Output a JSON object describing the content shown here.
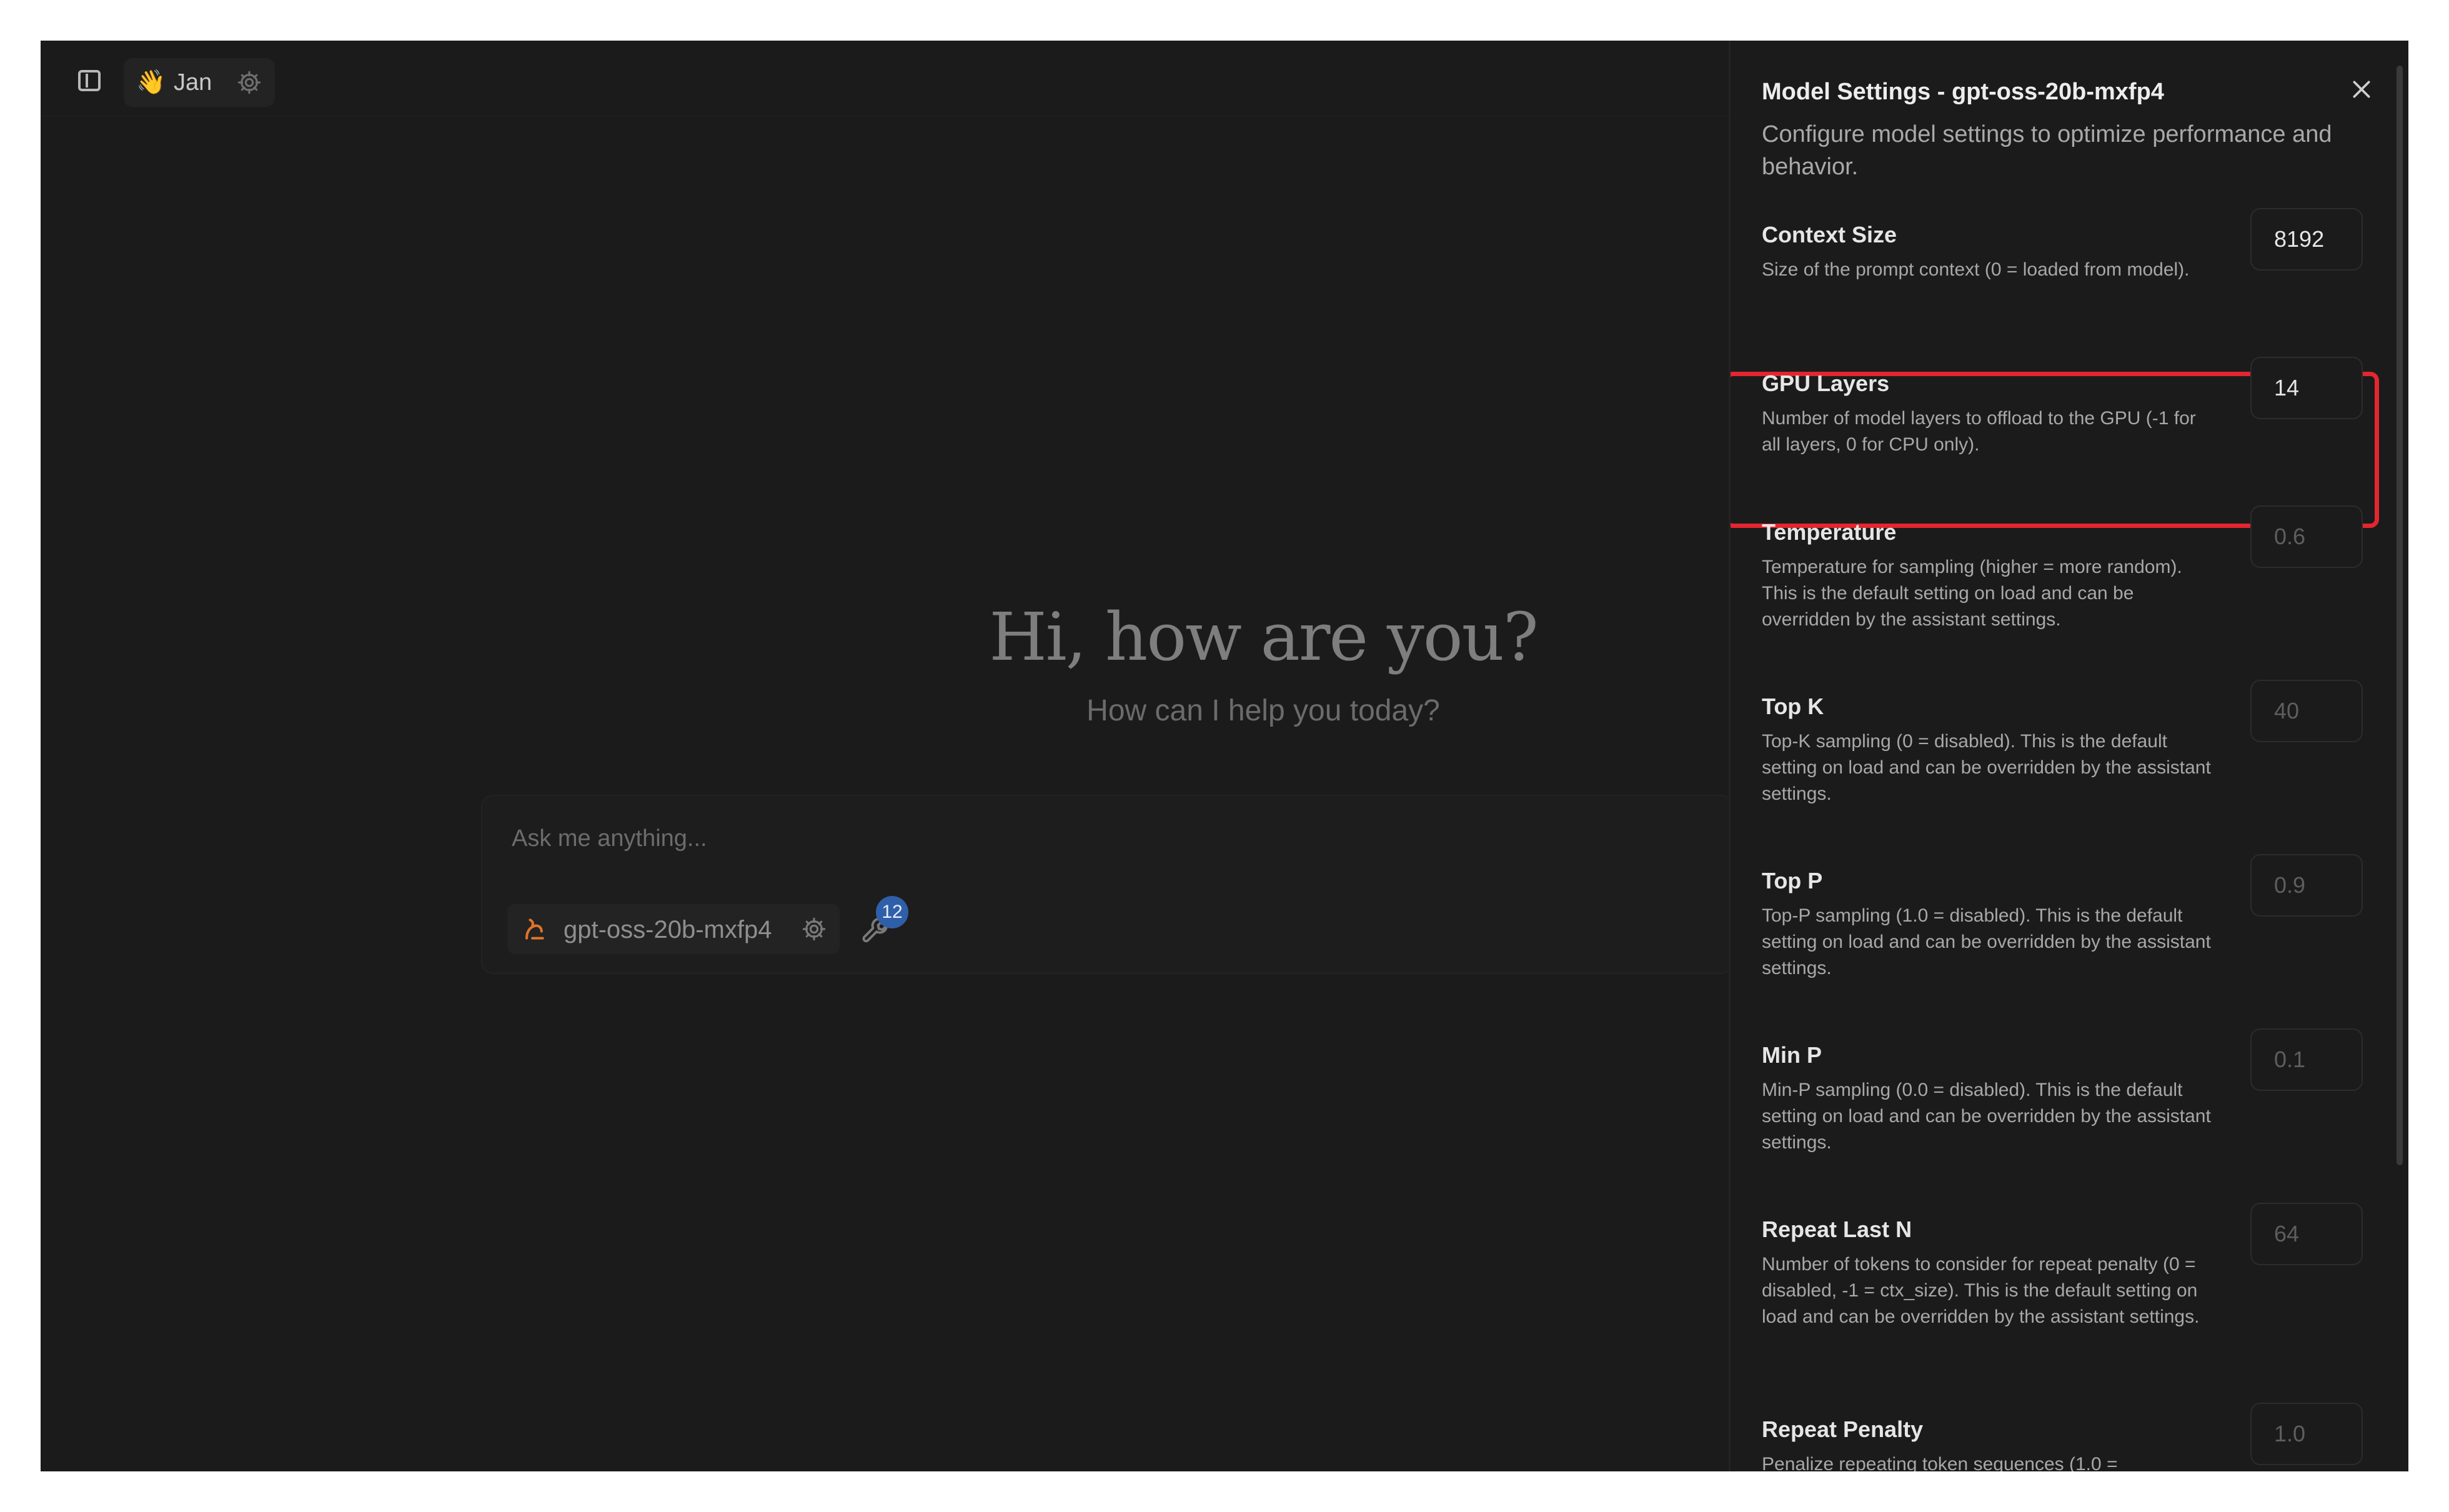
{
  "topbar": {
    "assistant_name": "Jan",
    "assistant_icon": "waving-hand-icon"
  },
  "main": {
    "greeting": "Hi, how are you?",
    "sub_greeting": "How can I help you today?"
  },
  "composer": {
    "placeholder": "Ask me anything...",
    "model_name": "gpt-oss-20b-mxfp4",
    "tools_count": "12"
  },
  "panel": {
    "title": "Model Settings - gpt-oss-20b-mxfp4",
    "description": "Configure model settings to optimize performance and behavior.",
    "settings": [
      {
        "title": "Context Size",
        "description": "Size of the prompt context (0 = loaded from model).",
        "value": "8192"
      },
      {
        "title": "GPU Layers",
        "description": "Number of model layers to offload to the GPU (-1 for all layers, 0 for CPU only).",
        "value": "14"
      },
      {
        "title": "Temperature",
        "description": "Temperature for sampling (higher = more random). This is the default setting on load and can be overridden by the assistant settings.",
        "placeholder": "0.6"
      },
      {
        "title": "Top K",
        "description": "Top-K sampling (0 = disabled). This is the default setting on load and can be overridden by the assistant settings.",
        "placeholder": "40"
      },
      {
        "title": "Top P",
        "description": "Top-P sampling (1.0 = disabled). This is the default setting on load and can be overridden by the assistant settings.",
        "placeholder": "0.9"
      },
      {
        "title": "Min P",
        "description": "Min-P sampling (0.0 = disabled). This is the default setting on load and can be overridden by the assistant settings.",
        "placeholder": "0.1"
      },
      {
        "title": "Repeat Last N",
        "description": "Number of tokens to consider for repeat penalty (0 = disabled, -1 = ctx_size). This is the default setting on load and can be overridden by the assistant settings.",
        "placeholder": "64"
      },
      {
        "title": "Repeat Penalty",
        "description": "Penalize repeating token sequences (1.0 =",
        "placeholder": "1.0"
      }
    ]
  },
  "colors": {
    "background": "#1b1b1b",
    "highlight": "#e3262f",
    "badge": "#2f5fa8",
    "model_logo": "#e0742a"
  }
}
